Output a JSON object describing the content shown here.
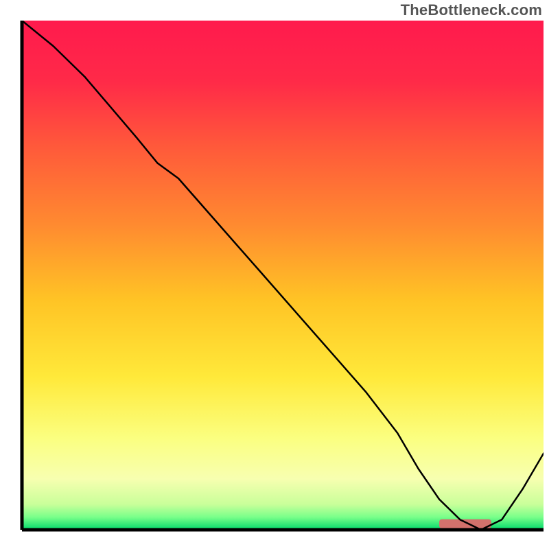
{
  "watermark": "TheBottleneck.com",
  "chart_data": {
    "type": "line",
    "title": "",
    "xlabel": "",
    "ylabel": "",
    "xlim": [
      0,
      100
    ],
    "ylim": [
      0,
      100
    ],
    "background_gradient": {
      "stops": [
        {
          "pos": 0.0,
          "color": "#ff1a4d"
        },
        {
          "pos": 0.12,
          "color": "#ff2a48"
        },
        {
          "pos": 0.25,
          "color": "#ff5a3a"
        },
        {
          "pos": 0.4,
          "color": "#ff8a30"
        },
        {
          "pos": 0.55,
          "color": "#ffc425"
        },
        {
          "pos": 0.7,
          "color": "#ffe93a"
        },
        {
          "pos": 0.82,
          "color": "#fbff80"
        },
        {
          "pos": 0.9,
          "color": "#f7ffb0"
        },
        {
          "pos": 0.95,
          "color": "#c9ff9a"
        },
        {
          "pos": 0.975,
          "color": "#7aff8a"
        },
        {
          "pos": 1.0,
          "color": "#00d96b"
        }
      ]
    },
    "series": [
      {
        "name": "bottleneck-curve",
        "color": "#000000",
        "width": 2.5,
        "x": [
          0,
          6,
          12,
          17,
          22,
          26,
          30,
          36,
          42,
          48,
          54,
          60,
          66,
          72,
          76,
          80,
          84,
          88,
          92,
          96,
          100
        ],
        "y": [
          100,
          95,
          89,
          83,
          77,
          72,
          69,
          62,
          55,
          48,
          41,
          34,
          27,
          19,
          12,
          6,
          2,
          0,
          2,
          8,
          15
        ]
      }
    ],
    "marker": {
      "name": "optimal-range-marker",
      "color": "#d2716c",
      "x_start": 80,
      "x_end": 90,
      "y": 0,
      "thickness_pct": 1.0
    },
    "axes": {
      "stroke": "#000000",
      "width": 5
    }
  }
}
